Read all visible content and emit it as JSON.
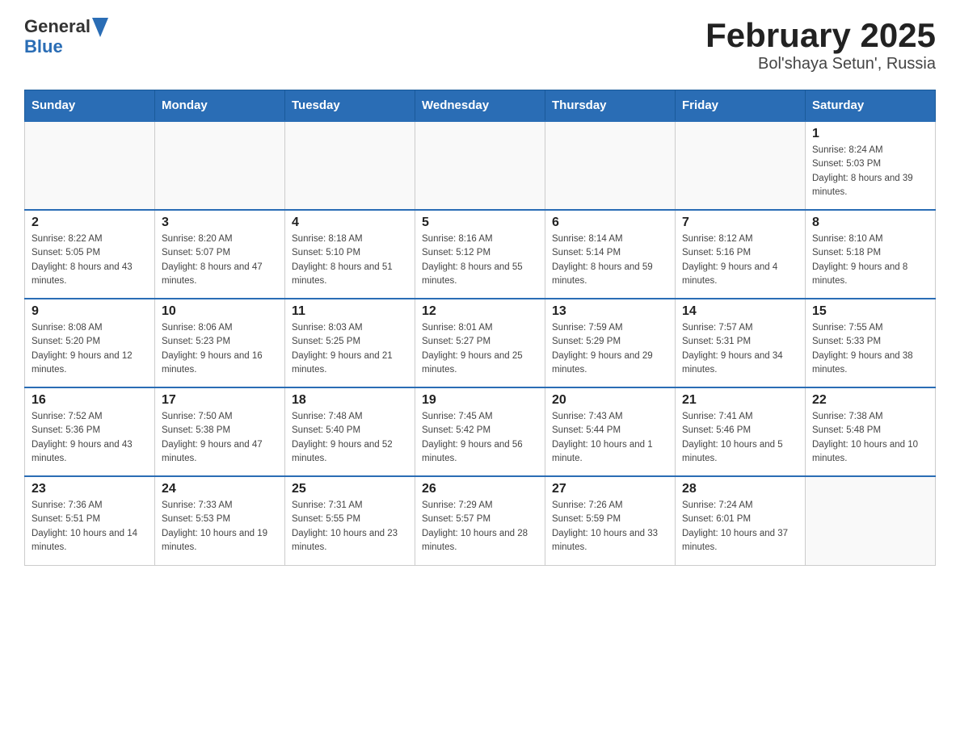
{
  "header": {
    "logo_general": "General",
    "logo_blue": "Blue",
    "title": "February 2025",
    "subtitle": "Bol'shaya Setun', Russia"
  },
  "days_of_week": [
    "Sunday",
    "Monday",
    "Tuesday",
    "Wednesday",
    "Thursday",
    "Friday",
    "Saturday"
  ],
  "weeks": [
    {
      "days": [
        {
          "number": "",
          "info": ""
        },
        {
          "number": "",
          "info": ""
        },
        {
          "number": "",
          "info": ""
        },
        {
          "number": "",
          "info": ""
        },
        {
          "number": "",
          "info": ""
        },
        {
          "number": "",
          "info": ""
        },
        {
          "number": "1",
          "info": "Sunrise: 8:24 AM\nSunset: 5:03 PM\nDaylight: 8 hours and 39 minutes."
        }
      ]
    },
    {
      "days": [
        {
          "number": "2",
          "info": "Sunrise: 8:22 AM\nSunset: 5:05 PM\nDaylight: 8 hours and 43 minutes."
        },
        {
          "number": "3",
          "info": "Sunrise: 8:20 AM\nSunset: 5:07 PM\nDaylight: 8 hours and 47 minutes."
        },
        {
          "number": "4",
          "info": "Sunrise: 8:18 AM\nSunset: 5:10 PM\nDaylight: 8 hours and 51 minutes."
        },
        {
          "number": "5",
          "info": "Sunrise: 8:16 AM\nSunset: 5:12 PM\nDaylight: 8 hours and 55 minutes."
        },
        {
          "number": "6",
          "info": "Sunrise: 8:14 AM\nSunset: 5:14 PM\nDaylight: 8 hours and 59 minutes."
        },
        {
          "number": "7",
          "info": "Sunrise: 8:12 AM\nSunset: 5:16 PM\nDaylight: 9 hours and 4 minutes."
        },
        {
          "number": "8",
          "info": "Sunrise: 8:10 AM\nSunset: 5:18 PM\nDaylight: 9 hours and 8 minutes."
        }
      ]
    },
    {
      "days": [
        {
          "number": "9",
          "info": "Sunrise: 8:08 AM\nSunset: 5:20 PM\nDaylight: 9 hours and 12 minutes."
        },
        {
          "number": "10",
          "info": "Sunrise: 8:06 AM\nSunset: 5:23 PM\nDaylight: 9 hours and 16 minutes."
        },
        {
          "number": "11",
          "info": "Sunrise: 8:03 AM\nSunset: 5:25 PM\nDaylight: 9 hours and 21 minutes."
        },
        {
          "number": "12",
          "info": "Sunrise: 8:01 AM\nSunset: 5:27 PM\nDaylight: 9 hours and 25 minutes."
        },
        {
          "number": "13",
          "info": "Sunrise: 7:59 AM\nSunset: 5:29 PM\nDaylight: 9 hours and 29 minutes."
        },
        {
          "number": "14",
          "info": "Sunrise: 7:57 AM\nSunset: 5:31 PM\nDaylight: 9 hours and 34 minutes."
        },
        {
          "number": "15",
          "info": "Sunrise: 7:55 AM\nSunset: 5:33 PM\nDaylight: 9 hours and 38 minutes."
        }
      ]
    },
    {
      "days": [
        {
          "number": "16",
          "info": "Sunrise: 7:52 AM\nSunset: 5:36 PM\nDaylight: 9 hours and 43 minutes."
        },
        {
          "number": "17",
          "info": "Sunrise: 7:50 AM\nSunset: 5:38 PM\nDaylight: 9 hours and 47 minutes."
        },
        {
          "number": "18",
          "info": "Sunrise: 7:48 AM\nSunset: 5:40 PM\nDaylight: 9 hours and 52 minutes."
        },
        {
          "number": "19",
          "info": "Sunrise: 7:45 AM\nSunset: 5:42 PM\nDaylight: 9 hours and 56 minutes."
        },
        {
          "number": "20",
          "info": "Sunrise: 7:43 AM\nSunset: 5:44 PM\nDaylight: 10 hours and 1 minute."
        },
        {
          "number": "21",
          "info": "Sunrise: 7:41 AM\nSunset: 5:46 PM\nDaylight: 10 hours and 5 minutes."
        },
        {
          "number": "22",
          "info": "Sunrise: 7:38 AM\nSunset: 5:48 PM\nDaylight: 10 hours and 10 minutes."
        }
      ]
    },
    {
      "days": [
        {
          "number": "23",
          "info": "Sunrise: 7:36 AM\nSunset: 5:51 PM\nDaylight: 10 hours and 14 minutes."
        },
        {
          "number": "24",
          "info": "Sunrise: 7:33 AM\nSunset: 5:53 PM\nDaylight: 10 hours and 19 minutes."
        },
        {
          "number": "25",
          "info": "Sunrise: 7:31 AM\nSunset: 5:55 PM\nDaylight: 10 hours and 23 minutes."
        },
        {
          "number": "26",
          "info": "Sunrise: 7:29 AM\nSunset: 5:57 PM\nDaylight: 10 hours and 28 minutes."
        },
        {
          "number": "27",
          "info": "Sunrise: 7:26 AM\nSunset: 5:59 PM\nDaylight: 10 hours and 33 minutes."
        },
        {
          "number": "28",
          "info": "Sunrise: 7:24 AM\nSunset: 6:01 PM\nDaylight: 10 hours and 37 minutes."
        },
        {
          "number": "",
          "info": ""
        }
      ]
    }
  ]
}
